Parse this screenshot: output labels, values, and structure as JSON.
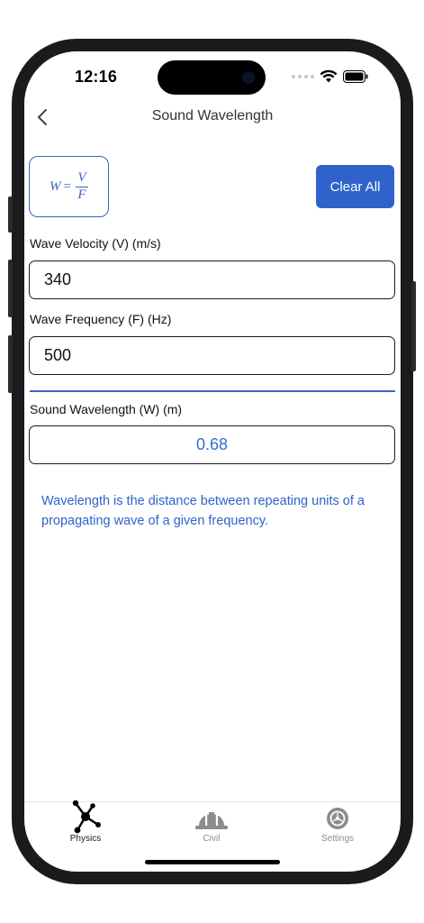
{
  "status_bar": {
    "time": "12:16"
  },
  "nav": {
    "title": "Sound Wavelength",
    "back_icon": "chevron-left-icon"
  },
  "formula": {
    "lhs": "W",
    "eq": "=",
    "numerator": "V",
    "denominator": "F"
  },
  "clear_button": {
    "label": "Clear All"
  },
  "velocity": {
    "label": "Wave Velocity (V) (m/s)",
    "value": "340"
  },
  "frequency": {
    "label": "Wave Frequency (F) (Hz)",
    "value": "500"
  },
  "wavelength": {
    "label": "Sound Wavelength (W) (m)",
    "value": "0.68"
  },
  "description": "Wavelength is the distance between repeating units of a propagating wave of a given frequency.",
  "tabs": [
    {
      "label": "Physics",
      "icon": "molecule-icon",
      "active": true
    },
    {
      "label": "Civil",
      "icon": "hard-hat-icon",
      "active": false
    },
    {
      "label": "Settings",
      "icon": "gear-icon",
      "active": false
    }
  ],
  "colors": {
    "accent": "#2f63cb",
    "result_text": "#3a6ad6",
    "inactive_tab": "#8c8c8c"
  }
}
